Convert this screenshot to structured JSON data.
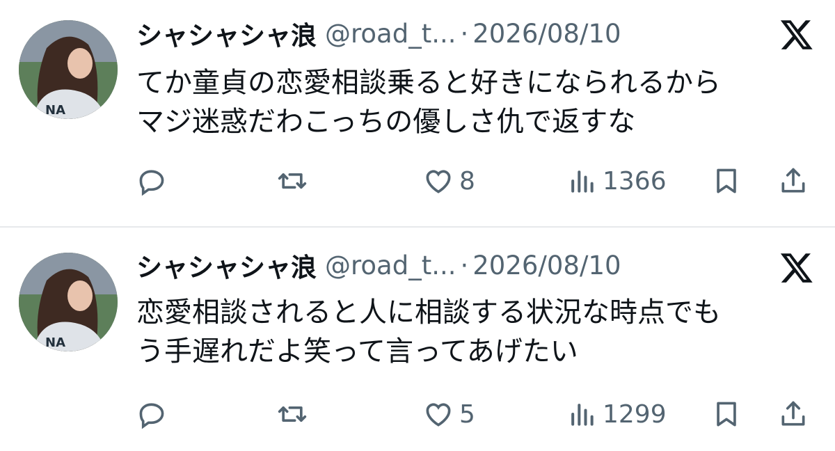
{
  "tweets": [
    {
      "author_name": "シャシャシャ浪",
      "handle": "@road_t...",
      "separator": "·",
      "date": "2026/08/10",
      "text_lines": [
        "てか童貞の恋愛相談乗ると好きになられるから",
        "マジ迷惑だわこっちの優しさ仇で返すな"
      ],
      "likes": "8",
      "views": "1366"
    },
    {
      "author_name": "シャシャシャ浪",
      "handle": "@road_t...",
      "separator": "·",
      "date": "2026/08/10",
      "text_lines": [
        "恋愛相談されると人に相談する状況な時点でも",
        "う手遅れだよ笑って言ってあげたい"
      ],
      "likes": "5",
      "views": "1299"
    }
  ],
  "icons": {
    "brand": "x-logo-icon",
    "reply": "reply-icon",
    "retweet": "retweet-icon",
    "like": "heart-icon",
    "views": "views-chart-icon",
    "bookmark": "bookmark-icon",
    "share": "share-icon"
  },
  "colors": {
    "text": "#0f1419",
    "secondary": "#536471",
    "divider": "#e6e9eb",
    "background": "#ffffff"
  }
}
